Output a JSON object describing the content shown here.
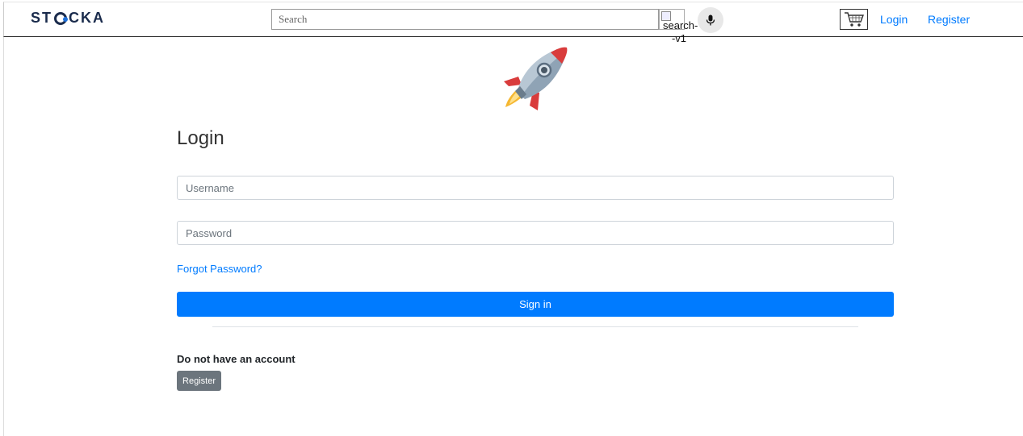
{
  "header": {
    "logo_text_left": "ST",
    "logo_text_right": "CKA",
    "search": {
      "placeholder": "Search",
      "value": ""
    },
    "search_image_alt": "search--v1",
    "nav": {
      "login_label": "Login",
      "register_label": "Register"
    },
    "icons": {
      "mic": "mic-icon",
      "cart": "cart-icon",
      "search_image": "broken-image-icon"
    }
  },
  "hero": {
    "icon": "rocket-icon"
  },
  "login_form": {
    "title": "Login",
    "username_placeholder": "Username",
    "password_placeholder": "Password",
    "forgot_label": "Forgot Password?",
    "signin_label": "Sign in",
    "no_account_text": "Do not have an account",
    "register_label": "Register"
  },
  "colors": {
    "primary": "#007bff",
    "secondary": "#6c757d",
    "logo": "#1a2b4c"
  }
}
